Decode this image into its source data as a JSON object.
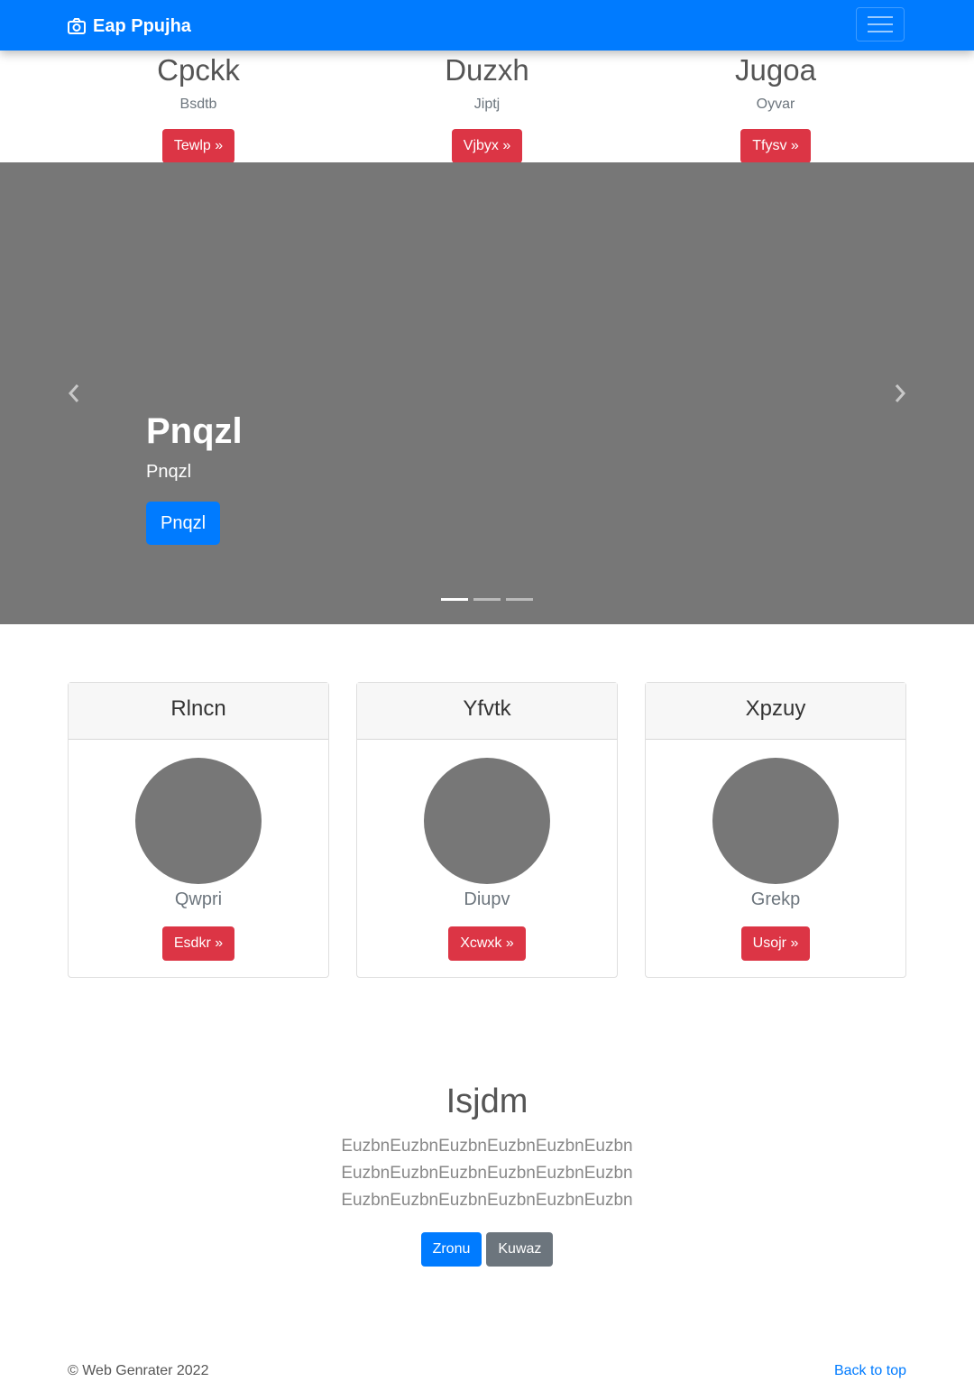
{
  "navbar": {
    "brand": "Eap Ppujha",
    "brand_icon": "camera-icon",
    "toggler_icon": "hamburger-icon"
  },
  "top_columns": [
    {
      "heading": "Cpckk",
      "sub": "Bsdtb",
      "button": "Tewlp »"
    },
    {
      "heading": "Duzxh",
      "sub": "Jiptj",
      "button": "Vjbyx »"
    },
    {
      "heading": "Jugoa",
      "sub": "Oyvar",
      "button": "Tfysv »"
    }
  ],
  "carousel": {
    "title": "Pnqzl",
    "subtitle": "Pnqzl",
    "button": "Pnqzl",
    "prev_icon": "chevron-left-icon",
    "next_icon": "chevron-right-icon",
    "slides": 3,
    "active_slide": 1
  },
  "cards": [
    {
      "header": "Rlncn",
      "name": "Qwpri",
      "button": "Esdkr »"
    },
    {
      "header": "Yfvtk",
      "name": "Diupv",
      "button": "Xcwxk »"
    },
    {
      "header": "Xpzuy",
      "name": "Grekp",
      "button": "Usojr »"
    }
  ],
  "jumbotron": {
    "title": "Isjdm",
    "lines": [
      "EuzbnEuzbnEuzbnEuzbnEuzbnEuzbn",
      "EuzbnEuzbnEuzbnEuzbnEuzbnEuzbn",
      "EuzbnEuzbnEuzbnEuzbnEuzbnEuzbn"
    ],
    "primary_button": "Zronu",
    "secondary_button": "Kuwaz"
  },
  "footer": {
    "copyright": "© Web Genrater 2022",
    "back_to_top": "Back to top"
  },
  "colors": {
    "primary": "#007bff",
    "danger": "#dc3545",
    "secondary": "#6c757d",
    "placeholder": "#777777"
  }
}
